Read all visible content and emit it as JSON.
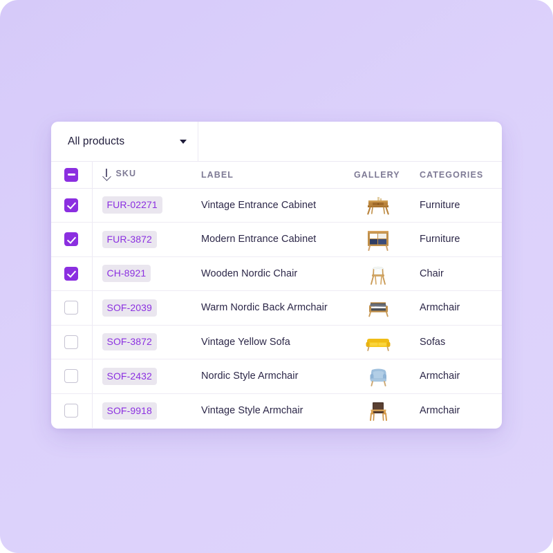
{
  "theme": {
    "background_start": "#d6caf9",
    "background_end": "#ded4fb",
    "card_background": "#ffffff",
    "accent": "#8b2fe0",
    "badge_background": "#eae6ef",
    "header_text": "#7e7a95",
    "body_text": "#2c2748",
    "border": "#ece9f3"
  },
  "toolbar": {
    "filter_select_value": "All products",
    "filter_select_icon": "chevron-down-icon"
  },
  "table": {
    "columns": [
      {
        "key": "select",
        "label": "",
        "icon": "checkbox-indeterminate-icon"
      },
      {
        "key": "sku",
        "label": "SKU",
        "sort_icon": "arrow-down-icon"
      },
      {
        "key": "label",
        "label": "LABEL"
      },
      {
        "key": "gallery",
        "label": "GALLERY"
      },
      {
        "key": "categories",
        "label": "CATEGORIES"
      }
    ],
    "header_select_state": "indeterminate",
    "rows": [
      {
        "selected": true,
        "sku": "FUR-02271",
        "label": "Vintage Entrance Cabinet",
        "gallery_icon": "wooden-console-cabinet-thumbnail",
        "categories": "Furniture"
      },
      {
        "selected": true,
        "sku": "FUR-3872",
        "label": "Modern Entrance Cabinet",
        "gallery_icon": "navy-white-sideboard-thumbnail",
        "categories": "Furniture"
      },
      {
        "selected": true,
        "sku": "CH-8921",
        "label": "Wooden Nordic Chair",
        "gallery_icon": "white-wooden-chair-thumbnail",
        "categories": "Chair"
      },
      {
        "selected": false,
        "sku": "SOF-2039",
        "label": "Warm Nordic Back Armchair",
        "gallery_icon": "grey-cushion-armchair-thumbnail",
        "categories": "Armchair"
      },
      {
        "selected": false,
        "sku": "SOF-3872",
        "label": "Vintage Yellow Sofa",
        "gallery_icon": "yellow-sofa-thumbnail",
        "categories": "Sofas"
      },
      {
        "selected": false,
        "sku": "SOF-2432",
        "label": "Nordic Style Armchair",
        "gallery_icon": "blue-upholstered-armchair-thumbnail",
        "categories": "Armchair"
      },
      {
        "selected": false,
        "sku": "SOF-9918",
        "label": "Vintage Style Armchair",
        "gallery_icon": "brown-wooden-armchair-thumbnail",
        "categories": "Armchair"
      }
    ]
  }
}
